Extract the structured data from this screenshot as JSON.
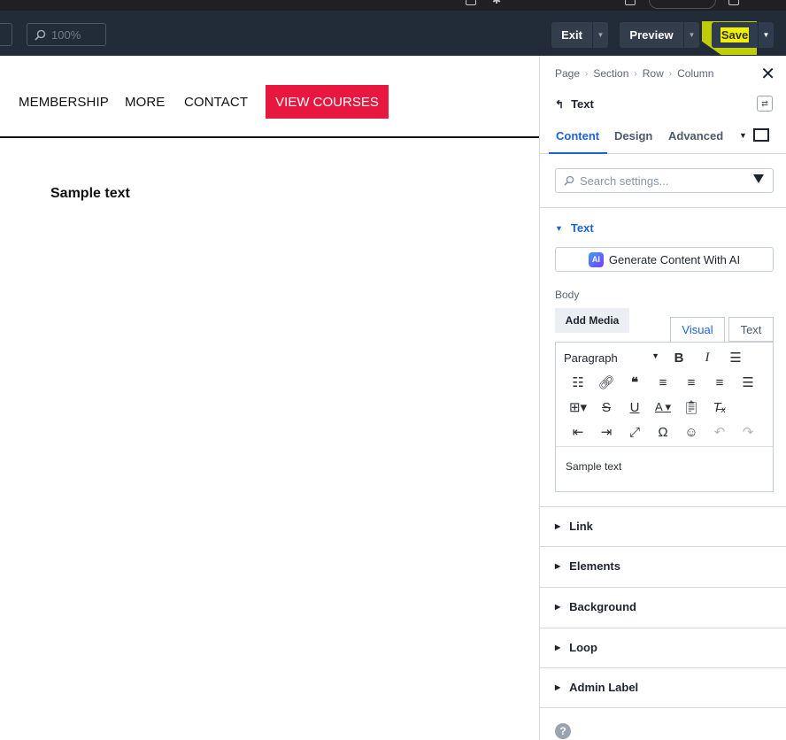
{
  "toolbar": {
    "zoom": "100%",
    "exit_label": "Exit",
    "preview_label": "Preview",
    "save_label": "Save"
  },
  "canvas": {
    "nav_items": [
      "MEMBERSHIP",
      "MORE",
      "CONTACT"
    ],
    "cta_label": "VIEW COURSES",
    "sample_text": "Sample text"
  },
  "panel": {
    "breadcrumb": [
      "Page",
      "Section",
      "Row",
      "Column"
    ],
    "element_title": "Text",
    "tabs": [
      "Content",
      "Design",
      "Advanced"
    ],
    "search_placeholder": "Search settings...",
    "open_section": "Text",
    "ai_button": "Generate Content With AI",
    "ai_badge": "AI",
    "body_label": "Body",
    "add_media": "Add Media",
    "visual_tab": "Visual",
    "text_tab": "Text",
    "paragraph_select": "Paragraph",
    "editor_content": "Sample text",
    "collapsed_sections": [
      "Link",
      "Elements",
      "Background",
      "Loop",
      "Admin Label"
    ],
    "help": "?"
  },
  "colors": {
    "accent": "#1a64d6",
    "cta": "#e8173f",
    "toolbar_bg": "#222b38",
    "save_highlight": "#f0f000"
  }
}
